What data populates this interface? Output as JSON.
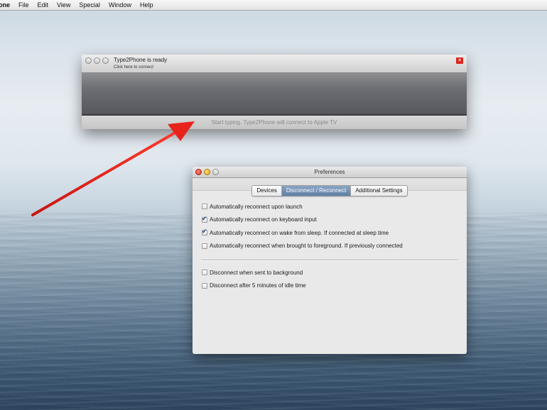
{
  "menubar": {
    "app": "one",
    "items": [
      "File",
      "Edit",
      "View",
      "Special",
      "Window",
      "Help"
    ]
  },
  "type2phone": {
    "title": "Type2Phone is ready",
    "subtitle": "Click here to connect",
    "status": "Start typing. Type2Phone will connect to Apple TV"
  },
  "preferences": {
    "title": "Preferences",
    "tabs": [
      "Devices",
      "Disconnect / Reconnect",
      "Additional Settings"
    ],
    "active_tab": 1,
    "options": [
      {
        "label": "Automatically reconnect upon launch",
        "checked": false
      },
      {
        "label": "Automatically reconnect on keyboard input",
        "checked": true
      },
      {
        "label": "Automatically reconnect on wake from sleep. If connected at sleep time",
        "checked": true
      },
      {
        "label": "Automatically reconnect when brought to foreground. If previously connected",
        "checked": false
      }
    ],
    "options2": [
      {
        "label": "Disconnect when sent to background",
        "checked": false
      },
      {
        "label": "Disconnect after 5 minutes of idle time",
        "checked": false
      }
    ]
  },
  "colors": {
    "arrow": "#e8231c",
    "active_tab": "#6e8db3"
  },
  "icons": [
    "close-icon",
    "arrow-annotation"
  ]
}
